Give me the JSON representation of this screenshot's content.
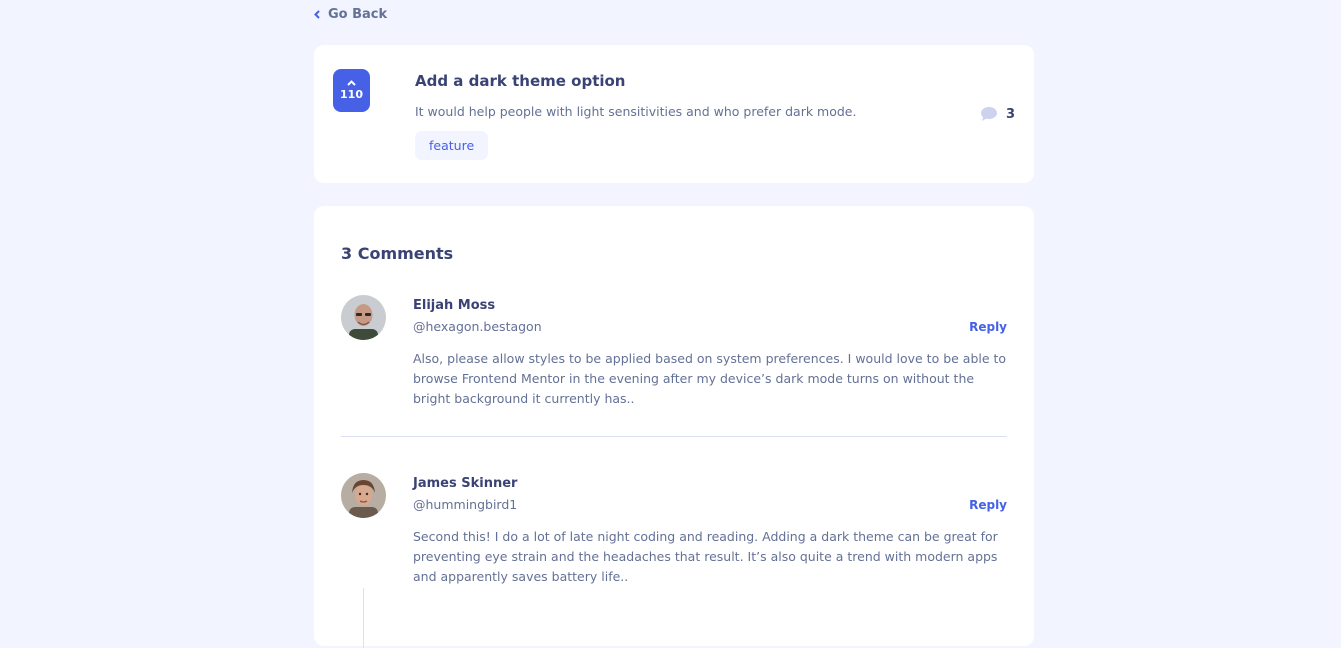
{
  "nav": {
    "back_label": "Go Back"
  },
  "feedback": {
    "upvotes": "110",
    "title": "Add a dark theme option",
    "description": "It would help people with light sensitivities and who prefer dark mode.",
    "tag": "feature",
    "comment_count": "3"
  },
  "comments_section": {
    "heading": "3 Comments",
    "comments": [
      {
        "name": "Elijah Moss",
        "handle": "@hexagon.bestagon",
        "reply_label": "Reply",
        "text": "Also, please allow styles to be applied based on system preferences. I would love to be able to browse Frontend Mentor in the evening after my device’s dark mode turns on without the bright background it currently has.."
      },
      {
        "name": "James Skinner",
        "handle": "@hummingbird1",
        "reply_label": "Reply",
        "text": "Second this! I do a lot of late night coding and reading. Adding a dark theme can be great for preventing eye strain and the headaches that result. It’s also quite a trend with modern apps and apparently saves battery life.."
      }
    ]
  },
  "colors": {
    "background": "#F2F4FF",
    "accent": "#4661E6",
    "heading": "#3A4374",
    "body_text": "#647196",
    "card": "#FFFFFF"
  },
  "icons": [
    "chevron-left-icon",
    "chevron-up-icon",
    "comment-bubble-icon"
  ]
}
